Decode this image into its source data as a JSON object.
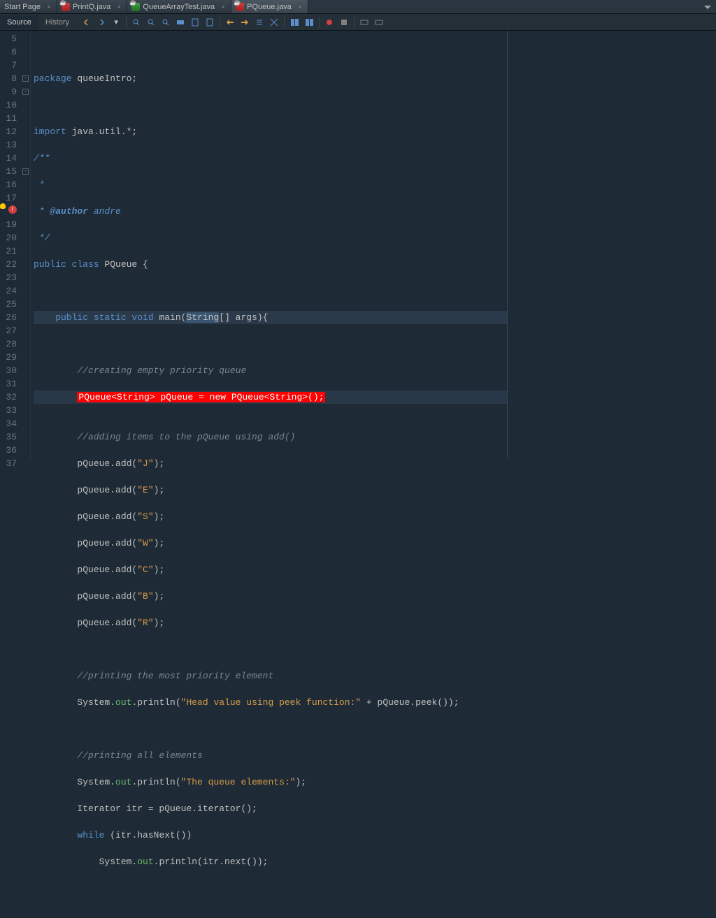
{
  "tabs": [
    {
      "label": "Start Page",
      "icon": "page"
    },
    {
      "label": "PrintQ.java",
      "icon": "java-red"
    },
    {
      "label": "QueueArrayTest.java",
      "icon": "java-grn"
    },
    {
      "label": "PQueue.java",
      "icon": "java-red",
      "active": true
    }
  ],
  "sub_tabs": {
    "source": "Source",
    "history": "History"
  },
  "gutter_start": 5,
  "gutter_end": 37,
  "fold_markers": {
    "8": "minus",
    "9": "minus",
    "15": "minus"
  },
  "error_line": 18,
  "code_lines": {
    "l5": "",
    "l6_kw": "package",
    "l6_pkg": " queueIntro;",
    "l7": "",
    "l8_kw": "import",
    "l8_rest": " java.util.*;",
    "l9": "/**",
    "l10": " *",
    "l11_a": " * @",
    "l11_b": "author",
    "l11_c": " andre",
    "l12": " */",
    "l13_a": "public",
    "l13_b": " class",
    "l13_c": " PQueue {",
    "l14": "",
    "l15_a": "    public",
    "l15_b": " static",
    "l15_c": " void",
    "l15_d": " main(",
    "l15_sel": "String",
    "l15_e": "[] args){",
    "l16": "",
    "l17": "        //creating empty priority queue",
    "l18_a": "        ",
    "l18_err": "PQueue<String> pQueue = new PQueue<String>();",
    "l19": "",
    "l20": "        //adding items to the pQueue using add()",
    "l21_a": "        pQueue.add(",
    "l21_s": "\"J\"",
    "l21_b": ");",
    "l22_a": "        pQueue.add(",
    "l22_s": "\"E\"",
    "l22_b": ");",
    "l23_a": "        pQueue.add(",
    "l23_s": "\"S\"",
    "l23_b": ");",
    "l24_a": "        pQueue.add(",
    "l24_s": "\"W\"",
    "l24_b": ");",
    "l25_a": "        pQueue.add(",
    "l25_s": "\"C\"",
    "l25_b": ");",
    "l26_a": "        pQueue.add(",
    "l26_s": "\"B\"",
    "l26_b": ");",
    "l27_a": "        pQueue.add(",
    "l27_s": "\"R\"",
    "l27_b": ");",
    "l28": "",
    "l29": "        //printing the most priority element",
    "l30_a": "        System.",
    "l30_g": "out",
    "l30_b": ".println(",
    "l30_s": "\"Head value using peek function:\"",
    "l30_c": " + pQueue.peek());",
    "l31": "",
    "l32": "        //printing all elements",
    "l33_a": "        System.",
    "l33_g": "out",
    "l33_b": ".println(",
    "l33_s": "\"The queue elements:\"",
    "l33_c": ");",
    "l34": "        Iterator itr = pQueue.iterator();",
    "l35_a": "        ",
    "l35_kw": "while",
    "l35_b": " (itr.hasNext())",
    "l36_a": "            System.",
    "l36_g": "out",
    "l36_b": ".println(itr.next());",
    "l37": ""
  }
}
